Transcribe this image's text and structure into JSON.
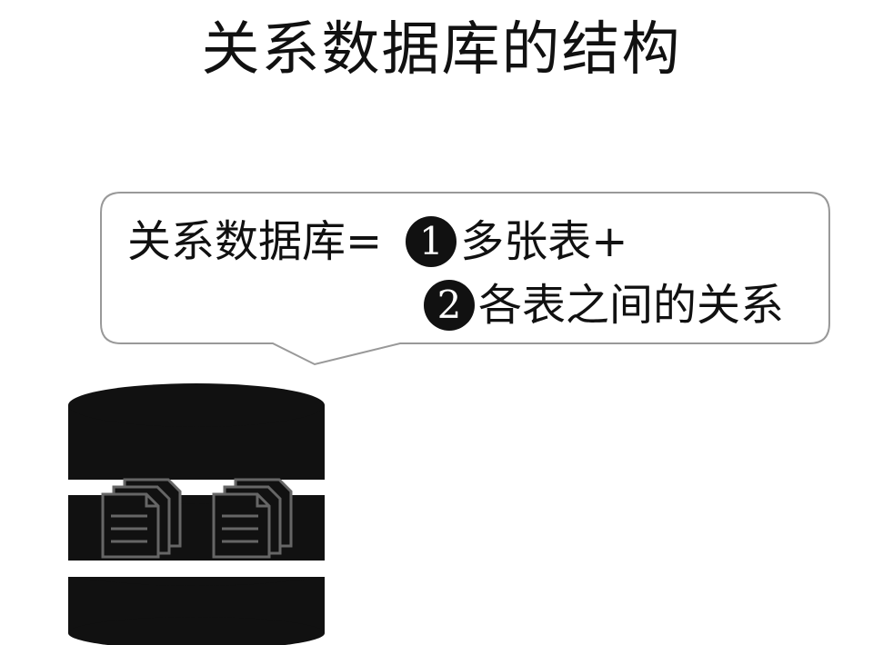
{
  "title": "关系数据库的结构",
  "definition": {
    "lhs": "关系数据库=",
    "items": [
      {
        "number": "1",
        "text": "多张表+"
      },
      {
        "number": "2",
        "text": "各表之间的关系"
      }
    ]
  },
  "icons": {
    "database": "database-icon",
    "document": "documents-icon"
  },
  "colors": {
    "ink": "#111111",
    "background": "#ffffff",
    "bubble_border": "#999999",
    "doc_icon": "#666666"
  }
}
